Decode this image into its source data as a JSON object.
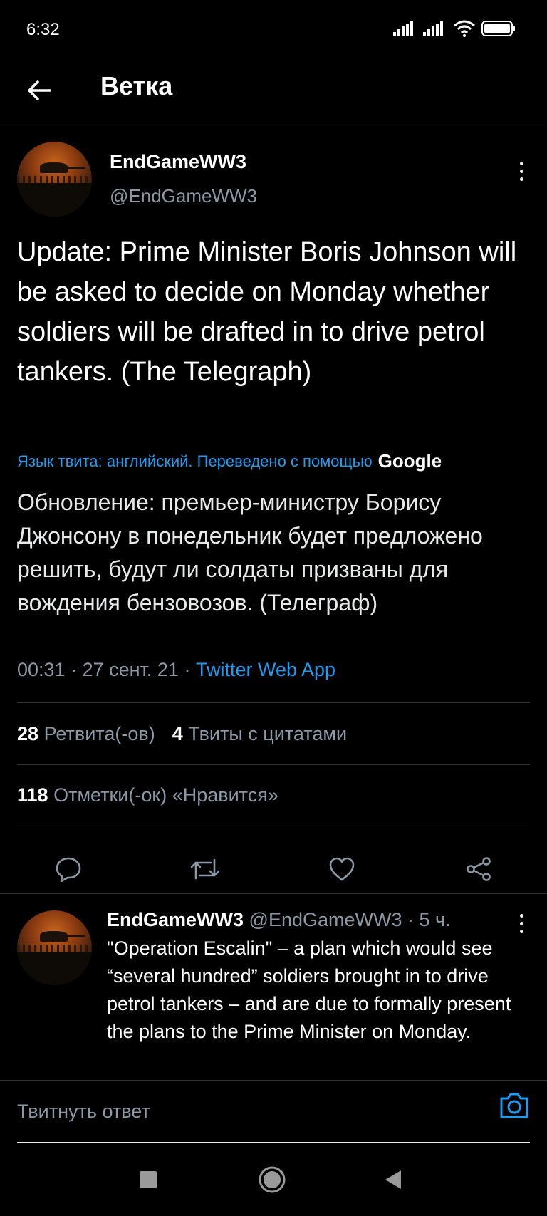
{
  "status_bar": {
    "time": "6:32"
  },
  "header": {
    "title": "Ветка"
  },
  "tweet": {
    "display_name": "EndGameWW3",
    "handle": "@EndGameWW3",
    "text": "Update: Prime Minister Boris Johnson will be asked to decide on Monday whether soldiers will be drafted in to drive petrol tankers. (The Telegraph)",
    "translation_note": "Язык твита: английский. Переведено с помощью",
    "translation_provider": "Google",
    "translated_text": "Обновление: премьер-министру Борису Джонсону в понедельник будет предложено решить, будут ли солдаты призваны для вождения бензовозов. (Телеграф)",
    "time": "00:31",
    "date": "27 сент. 21",
    "source": "Twitter Web App",
    "retweets_count": "28",
    "retweets_label": "Ретвита(-ов)",
    "quotes_count": "4",
    "quotes_label": "Твиты с цитатами",
    "likes_count": "118",
    "likes_label": "Отметки(-ок) «Нравится»"
  },
  "reply": {
    "display_name": "EndGameWW3",
    "handle": "@EndGameWW3",
    "age": "5 ч.",
    "text": "\"Operation Escalin\" – a plan which would see “several hundred” soldiers brought in to drive petrol tankers – and are due to formally present the plans to the Prime Minister on Monday."
  },
  "compose": {
    "placeholder": "Твитнуть ответ"
  },
  "colors": {
    "accent": "#1d9bf0",
    "background": "#000000",
    "muted": "#8b98a5",
    "divider": "#2f3336"
  },
  "icons": [
    "back-arrow-icon",
    "more-vert-icon",
    "reply-icon",
    "retweet-icon",
    "like-icon",
    "share-icon",
    "camera-icon",
    "signal-icon",
    "wifi-icon",
    "battery-icon"
  ]
}
